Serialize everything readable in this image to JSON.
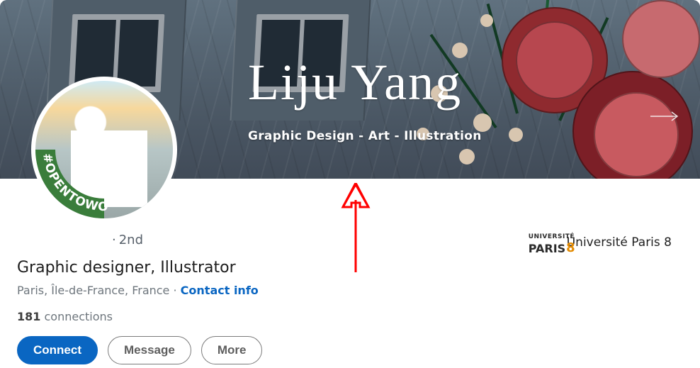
{
  "banner": {
    "signature_text": "Liju Yang",
    "tagline": "Graphic Design - Art - Illustration"
  },
  "avatar": {
    "open_to_work_badge": "#OPENTOWORK"
  },
  "profile": {
    "degree": "2nd",
    "degree_separator": "·",
    "headline": "Graphic designer, Illustrator",
    "location": "Paris, Île-de-France, France",
    "location_separator": " · ",
    "contact_info_label": "Contact info",
    "connections_count": "181",
    "connections_label": " connections"
  },
  "actions": {
    "connect": "Connect",
    "message": "Message",
    "more": "More"
  },
  "education": {
    "logo_small": "UNIVERSITÉ",
    "logo_big": "PARIS",
    "logo_num": "8",
    "name": "Université Paris 8"
  },
  "colors": {
    "primary": "#0a66c2",
    "annotation": "#ff0000"
  }
}
